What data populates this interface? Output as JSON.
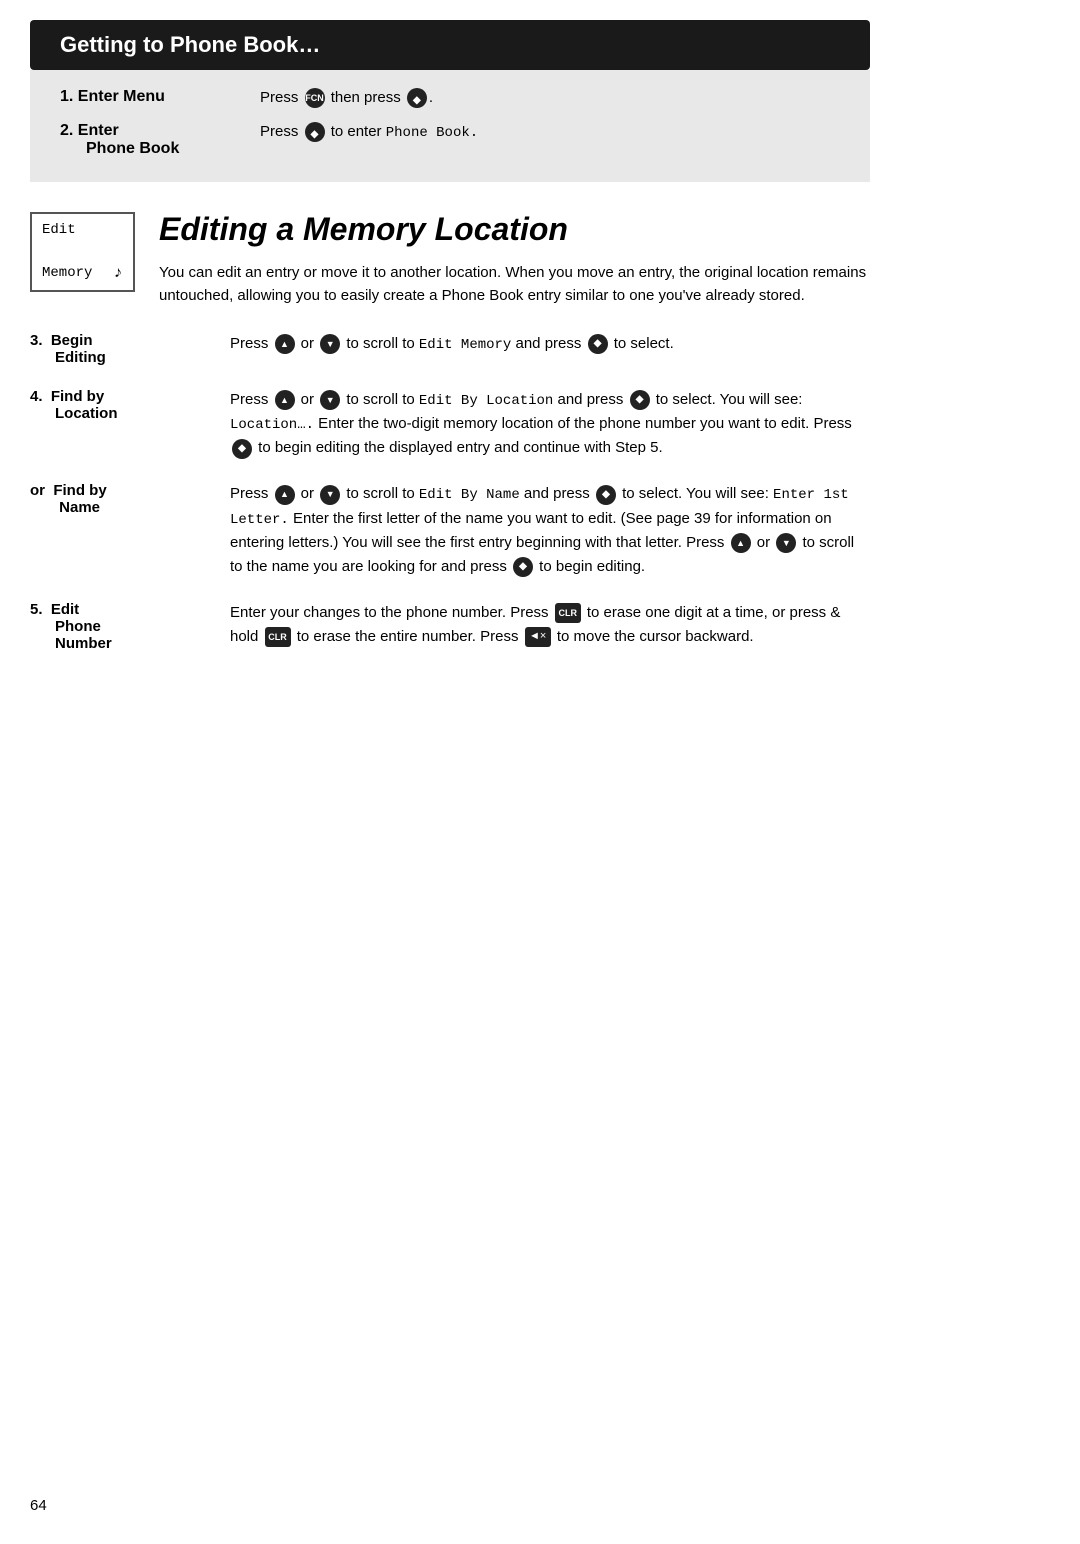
{
  "header": {
    "banner_title": "Getting to Phone Book…",
    "step1_label": "1.  Enter Menu",
    "step1_desc_pre": "Press",
    "step1_desc_mid": "then press",
    "step2_label": "2.  Enter\n    Phone Book",
    "step2_label_main": "2.  Enter",
    "step2_label_sub": "Phone Book",
    "step2_desc_pre": "Press",
    "step2_desc_mid": "to enter",
    "step2_desc_text": "Phone Book."
  },
  "sidebar": {
    "line1": "Edit",
    "line2": "Memory",
    "icon": "♪"
  },
  "section": {
    "title": "Editing a Memory Location",
    "intro": "You can edit an entry or move it to another location. When you move an entry, the original location remains untouched, allowing you to easily create a Phone Book entry similar to one you've already stored."
  },
  "steps": [
    {
      "number": "3.",
      "name": "Begin\nEditing",
      "name_line1": "Begin",
      "name_line2": "Editing",
      "content": "Press ▲ or ▼ to scroll to Edit Memory and press ◆ to select."
    },
    {
      "number": "4.",
      "name_line1": "Find by",
      "name_line2": "Location",
      "content": "Press ▲ or ▼ to scroll to Edit By Location and press ◆ to select. You will see: Location…. Enter the two-digit memory location of the phone number you want to edit. Press ◆ to begin editing the displayed entry and continue with Step 5."
    },
    {
      "or_prefix": "or",
      "number": "",
      "name_line1": "Find by",
      "name_line2": "Name",
      "content": "Press ▲ or ▼ to scroll to Edit By Name and press ◆ to select. You will see: Enter 1st Letter. Enter the first letter of the name you want to edit. (See page 39 for information on entering letters.) You will see the first entry beginning with that letter. Press ▲ or ▼ to scroll to the name you are looking for and press ◆ to begin editing."
    },
    {
      "number": "5.",
      "name_line1": "Edit",
      "name_line2": "Phone",
      "name_line3": "Number",
      "content": "Enter your changes to the phone number. Press CLR to erase one digit at a time, or press & hold CLR to erase the entire number. Press ◄× to move the cursor backward."
    }
  ],
  "page_number": "64"
}
